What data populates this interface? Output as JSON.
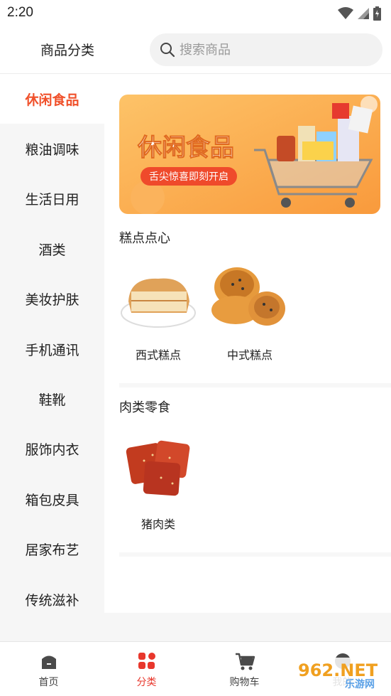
{
  "status_bar": {
    "time": "2:20"
  },
  "header": {
    "title": "商品分类",
    "search_placeholder": "搜索商品"
  },
  "sidebar": {
    "items": [
      {
        "label": "休闲食品",
        "active": true
      },
      {
        "label": "粮油调味"
      },
      {
        "label": "生活日用"
      },
      {
        "label": "酒类"
      },
      {
        "label": "美妆护肤"
      },
      {
        "label": "手机通讯"
      },
      {
        "label": "鞋靴"
      },
      {
        "label": "服饰内衣"
      },
      {
        "label": "箱包皮具"
      },
      {
        "label": "居家布艺"
      },
      {
        "label": "传统滋补"
      }
    ]
  },
  "banner": {
    "title": "休闲食品",
    "subtitle": "舌尖惊喜即刻开启"
  },
  "sections": [
    {
      "title": "糕点点心",
      "products": [
        {
          "label": "西式糕点"
        },
        {
          "label": "中式糕点"
        }
      ]
    },
    {
      "title": "肉类零食",
      "products": [
        {
          "label": "猪肉类"
        }
      ]
    }
  ],
  "tabbar": {
    "tabs": [
      {
        "label": "首页"
      },
      {
        "label": "分类",
        "active": true
      },
      {
        "label": "购物车"
      },
      {
        "label": "我的"
      }
    ]
  },
  "watermark": {
    "text": "962.NET",
    "subtext": "乐游网"
  },
  "colors": {
    "accent": "#f0512b",
    "tab_active": "#e8372c",
    "banner_bg": "#fcae4e"
  }
}
